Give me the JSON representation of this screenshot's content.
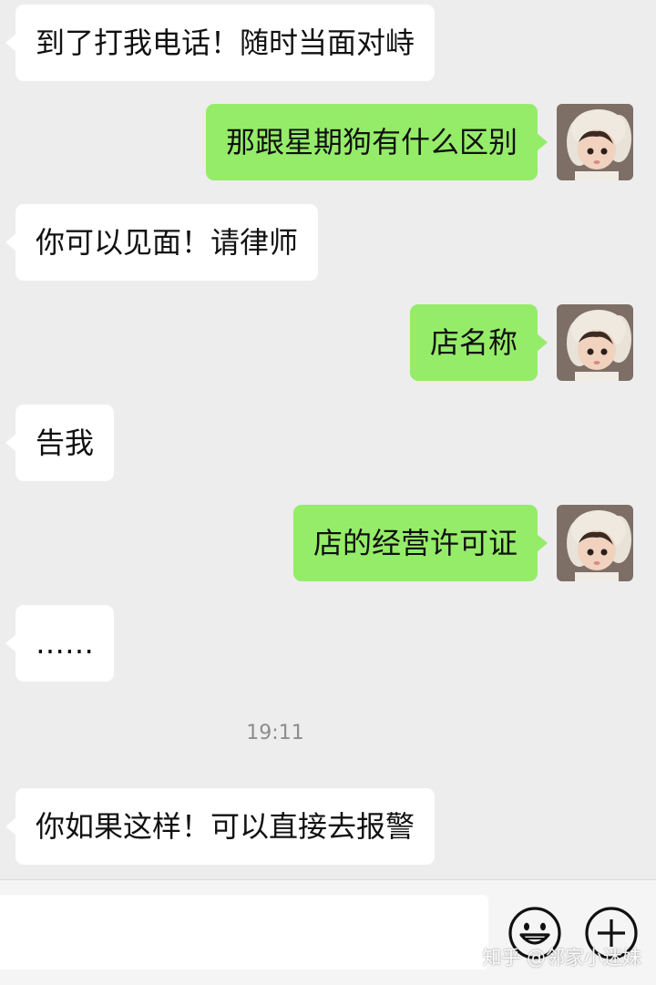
{
  "messages": [
    {
      "side": "in",
      "text": "到了打我电话！随时当面对峙"
    },
    {
      "side": "out",
      "text": "那跟星期狗有什么区别"
    },
    {
      "side": "in",
      "text": "你可以见面！请律师"
    },
    {
      "side": "out",
      "text": "店名称"
    },
    {
      "side": "in",
      "text": "告我"
    },
    {
      "side": "out",
      "text": "店的经营许可证"
    },
    {
      "side": "in",
      "text": "……"
    },
    {
      "side": "in",
      "text": "你如果这样！可以直接去报警"
    }
  ],
  "timestamp": "19:11",
  "input": {
    "value": ""
  },
  "icons": {
    "emoji": "smiley-face-icon",
    "more": "plus-circle-icon"
  },
  "colors": {
    "outgoing_bubble": "#95ec69",
    "incoming_bubble": "#ffffff",
    "background": "#ededed"
  },
  "watermark": "知乎 @邻家小迷妹"
}
